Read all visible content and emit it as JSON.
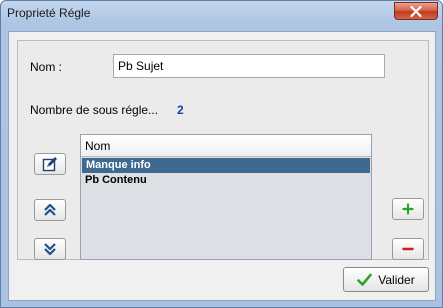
{
  "window": {
    "title": "Proprieté Régle"
  },
  "form": {
    "nom_label": "Nom :",
    "nom_value": "Pb Sujet",
    "count_label": "Nombre de sous régle...",
    "count_value": "2"
  },
  "list": {
    "header": "Nom",
    "rows": [
      {
        "label": "Manque info",
        "selected": true
      },
      {
        "label": "Pb Contenu",
        "selected": false
      }
    ]
  },
  "buttons": {
    "valider_label": "Valider"
  },
  "colors": {
    "accent_blue": "#1a3fb0",
    "selection": "#3f6a8f",
    "add_green": "#2aa52a",
    "remove_red": "#d01c1c"
  }
}
